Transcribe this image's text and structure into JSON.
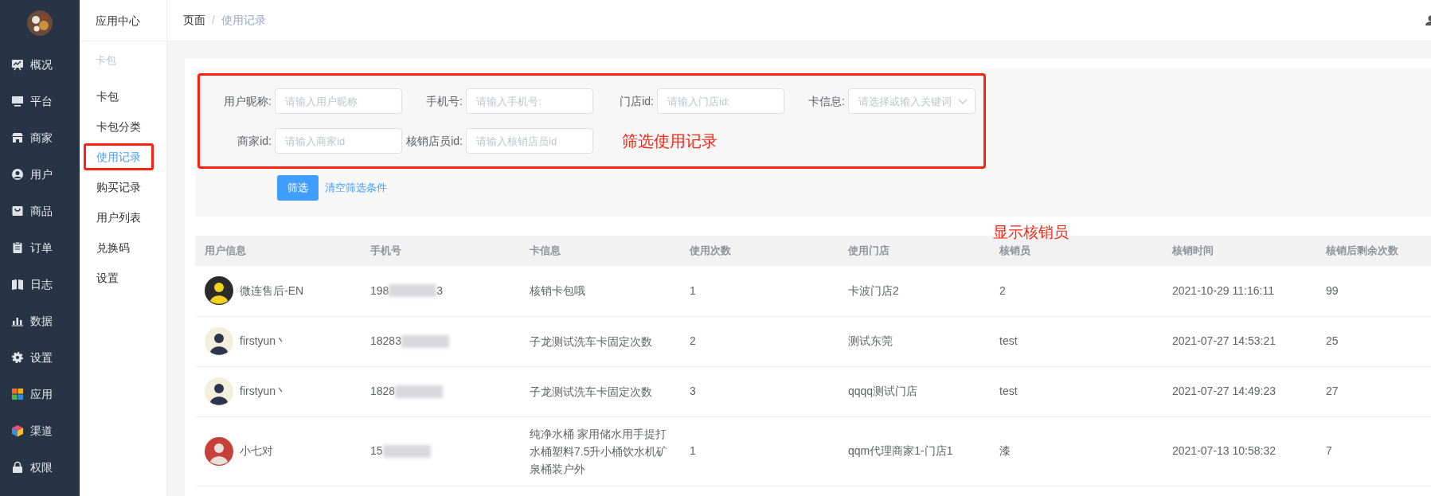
{
  "main_nav": [
    {
      "label": "概况"
    },
    {
      "label": "平台"
    },
    {
      "label": "商家"
    },
    {
      "label": "用户"
    },
    {
      "label": "商品"
    },
    {
      "label": "订单"
    },
    {
      "label": "日志"
    },
    {
      "label": "数据"
    },
    {
      "label": "设置"
    },
    {
      "label": "应用"
    },
    {
      "label": "渠道"
    },
    {
      "label": "权限"
    }
  ],
  "sub_nav": {
    "title": "应用中心",
    "group": "卡包",
    "items": [
      {
        "label": "卡包",
        "selected": false,
        "boxed": false
      },
      {
        "label": "卡包分类",
        "selected": false,
        "boxed": false
      },
      {
        "label": "使用记录",
        "selected": true,
        "boxed": true
      },
      {
        "label": "购买记录",
        "selected": false,
        "boxed": false
      },
      {
        "label": "用户列表",
        "selected": false,
        "boxed": false
      },
      {
        "label": "兑换码",
        "selected": false,
        "boxed": false
      },
      {
        "label": "设置",
        "selected": false,
        "boxed": false
      }
    ]
  },
  "breadcrumb": {
    "separator": "/",
    "items": [
      "页面",
      "使用记录"
    ]
  },
  "filter": {
    "boxed": true,
    "note": "筛选使用记录",
    "rows": [
      [
        {
          "label": "用户昵称:",
          "placeholder": "请输入用户昵称",
          "kind": "input"
        },
        {
          "label": "手机号:",
          "placeholder": "请输入手机号:",
          "kind": "input"
        },
        {
          "label": "门店id:",
          "placeholder": "请输入门店id:",
          "kind": "input"
        },
        {
          "label": "卡信息:",
          "placeholder": "请选择或输入关键词",
          "kind": "select"
        }
      ],
      [
        {
          "label": "商家id:",
          "placeholder": "请输入商家id",
          "kind": "input"
        },
        {
          "label": "核销店员id:",
          "placeholder": "请输入核销店员id",
          "kind": "input"
        }
      ]
    ],
    "submit": "筛选",
    "clear": "清空筛选条件"
  },
  "table": {
    "note": "显示核销员",
    "columns": [
      "用户信息",
      "手机号",
      "卡信息",
      "使用次数",
      "使用门店",
      "核销员",
      "核销时间",
      "核销后剩余次数"
    ],
    "rows": [
      {
        "user": "微连售后-EN",
        "phone": {
          "visible": "198",
          "tail": "3"
        },
        "card": "核销卡包哦",
        "uses": "1",
        "store": "卡波门店2",
        "staff": "2",
        "time": "2021-10-29 11:16:11",
        "remaining": "99"
      },
      {
        "user": "firstyun丶",
        "phone": {
          "visible": "18283"
        },
        "card": "子龙测试洗车卡固定次数",
        "uses": "2",
        "store": "测试东莞",
        "staff": "test",
        "time": "2021-07-27 14:53:21",
        "remaining": "25"
      },
      {
        "user": "firstyun丶",
        "phone": {
          "visible": "1828"
        },
        "card": "子龙测试洗车卡固定次数",
        "uses": "3",
        "store": "qqqq测试门店",
        "staff": "test",
        "time": "2021-07-27 14:49:23",
        "remaining": "27"
      },
      {
        "user": "小七对",
        "phone": {
          "visible": "15"
        },
        "card": "纯净水桶 家用储水用手提打水桶塑料7.5升小桶饮水机矿泉桶装户外",
        "uses": "1",
        "store": "qqm代理商家1-门店1",
        "staff": "漆",
        "time": "2021-07-13 10:58:32",
        "remaining": "7"
      }
    ]
  }
}
